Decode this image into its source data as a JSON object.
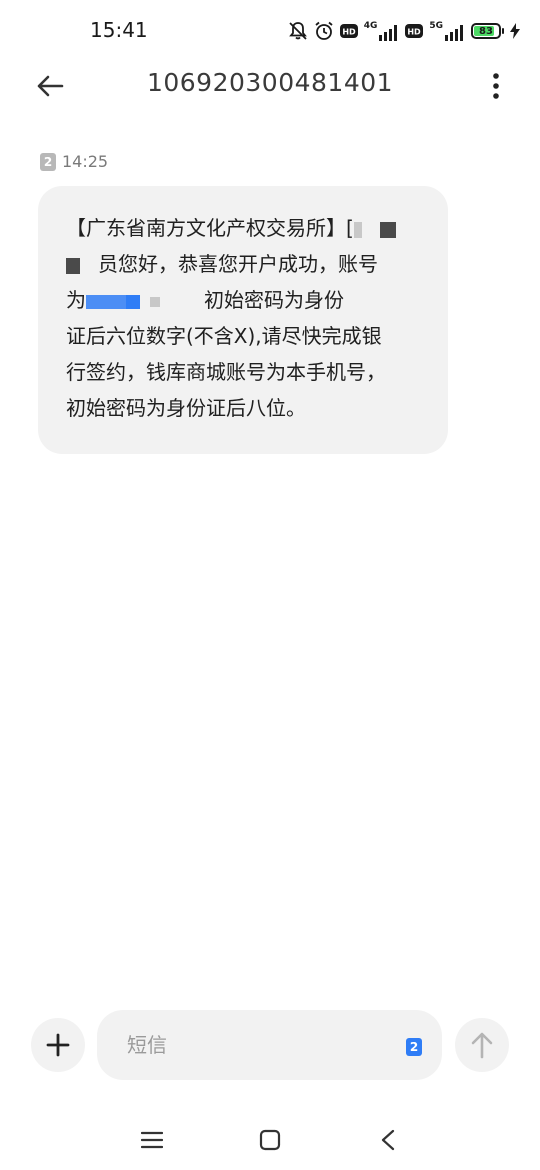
{
  "status_bar": {
    "time": "15:41",
    "battery_level": "83",
    "network_1": "4G",
    "network_2": "5G",
    "hd_label": "HD"
  },
  "header": {
    "title": "106920300481401"
  },
  "message": {
    "sim_slot": "2",
    "timestamp": "14:25",
    "line1": "【广东省南方文化产权交易所】[",
    "line2_text": "员您好，恭喜您开户成功，账号",
    "line3_prefix": "为",
    "line3_suffix": "初始密码为身份",
    "line4": "证后六位数字(不含X),请尽快完成银",
    "line5": "行签约，钱库商城账号为本手机号，",
    "line6": "初始密码为身份证后八位。"
  },
  "composer": {
    "placeholder": "短信",
    "sim_slot": "2"
  },
  "colors": {
    "bubble_bg": "#f2f2f2",
    "accent_blue": "#2f7df6",
    "battery_green": "#4cd964"
  }
}
